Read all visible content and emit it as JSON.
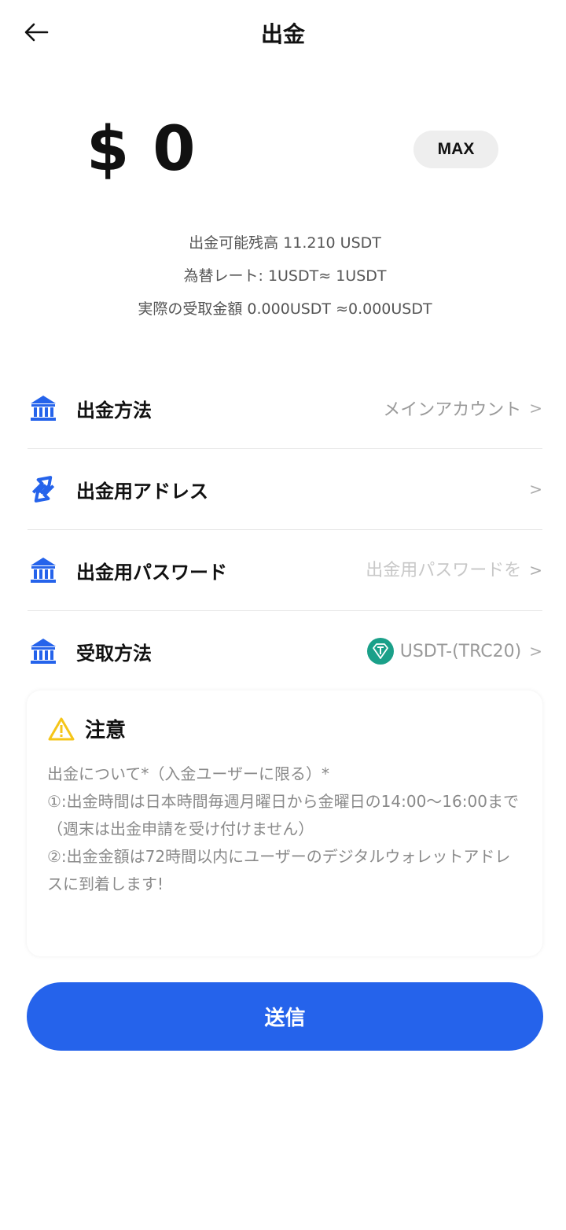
{
  "header": {
    "title": "出金"
  },
  "amount": {
    "currency": "$",
    "value": "0",
    "max_label": "MAX"
  },
  "info": {
    "available": "出金可能残高 11.210 USDT",
    "rate": "為替レート: 1USDT≈ 1USDT",
    "actual": "実際の受取金額 0.000USDT ≈0.000USDT"
  },
  "rows": {
    "method": {
      "label": "出金方法",
      "value": "メインアカウント",
      "icon": "bank-icon"
    },
    "address": {
      "label": "出金用アドレス",
      "value": "",
      "icon": "transfer-icon"
    },
    "password": {
      "label": "出金用パスワード",
      "placeholder": "出金用パスワードを",
      "icon": "bank-icon"
    },
    "receive": {
      "label": "受取方法",
      "value": "USDT-(TRC20)",
      "icon": "bank-icon",
      "token_icon": "tether-icon"
    },
    "chevron": ">"
  },
  "notice": {
    "title": "注意",
    "body": "出金について*（入金ユーザーに限る）*\n①:出金時間は日本時間毎週月曜日から金曜日の14:00〜16:00まで（週末は出金申請を受け付けません）\n②:出金金額は72時間以内にユーザーのデジタルウォレットアドレスに到着します!"
  },
  "submit": {
    "label": "送信"
  },
  "colors": {
    "accent": "#2563eb",
    "warning": "#f5c518",
    "token": "#1aa089"
  }
}
